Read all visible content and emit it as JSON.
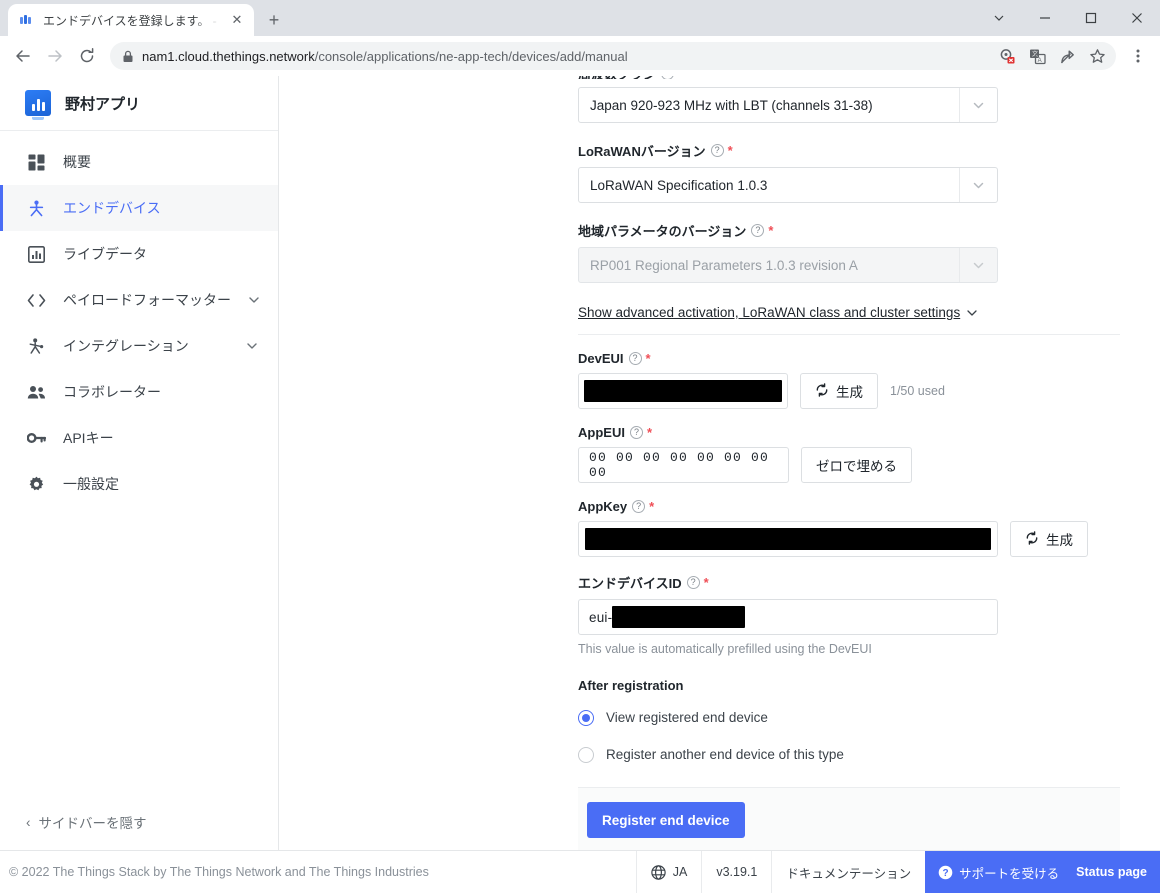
{
  "browser": {
    "tab": {
      "title": "エンドデバイスを登録します。 - 野村ア",
      "favicon_name": "thethings-favicon",
      "close_label": "✕"
    },
    "newtab_label": "+",
    "window_controls": {
      "more": "chevron-down",
      "minimize": "minimize",
      "maximize": "maximize",
      "close": "close"
    },
    "nav": {
      "back": "←",
      "forward": "→",
      "reload": "⟳"
    },
    "url_secure": "nam1.cloud.thethings.network",
    "url_path": "/console/applications/ne-app-tech/devices/add/manual",
    "omnibox_icons": [
      "cookie-blocked-icon",
      "translate-icon",
      "share-icon",
      "bookmark-star-icon"
    ],
    "menu_label": "⋮"
  },
  "sidebar": {
    "brand": "野村アプリ",
    "items": [
      {
        "label": "概要",
        "icon": "overview-grid-icon",
        "active": false,
        "expandable": false
      },
      {
        "label": "エンドデバイス",
        "icon": "end-device-icon",
        "active": true,
        "expandable": false
      },
      {
        "label": "ライブデータ",
        "icon": "live-data-icon",
        "active": false,
        "expandable": false
      },
      {
        "label": "ペイロードフォーマッター",
        "icon": "code-brackets-icon",
        "active": false,
        "expandable": true
      },
      {
        "label": "インテグレーション",
        "icon": "integration-icon",
        "active": false,
        "expandable": true
      },
      {
        "label": "コラボレーター",
        "icon": "collaborators-icon",
        "active": false,
        "expandable": false
      },
      {
        "label": "APIキー",
        "icon": "key-icon",
        "active": false,
        "expandable": false
      },
      {
        "label": "一般設定",
        "icon": "gear-icon",
        "active": false,
        "expandable": false
      }
    ],
    "collapse_label": "サイドバーを隠す",
    "collapse_caret": "‹"
  },
  "form": {
    "frequency_plan": {
      "label": "周波数プラン",
      "value": "Japan 920-923 MHz with LBT (channels 31-38)",
      "required": false,
      "disabled": false
    },
    "lorawan_version": {
      "label": "LoRaWANバージョン",
      "value": "LoRaWAN Specification 1.0.3",
      "required": true,
      "disabled": false
    },
    "regional_parameters": {
      "label": "地域パラメータのバージョン",
      "value": "RP001 Regional Parameters 1.0.3 revision A",
      "required": true,
      "disabled": true
    },
    "advanced_toggle": "Show advanced activation, LoRaWAN class and cluster settings",
    "dev_eui": {
      "label": "DevEUI",
      "required": true,
      "value_redacted": true,
      "generate_button": "生成",
      "used_note": "1/50 used"
    },
    "app_eui": {
      "label": "AppEUI",
      "required": true,
      "value": "00 00 00 00 00 00 00 00",
      "fill_button": "ゼロで埋める"
    },
    "app_key": {
      "label": "AppKey",
      "required": true,
      "value_redacted": true,
      "generate_button": "生成"
    },
    "end_device_id": {
      "label": "エンドデバイスID",
      "required": true,
      "value_prefix": "eui-",
      "value_redacted": true,
      "help": "This value is automatically prefilled using the DevEUI"
    },
    "after_registration": {
      "title": "After registration",
      "options": [
        {
          "label": "View registered end device",
          "selected": true
        },
        {
          "label": "Register another end device of this type",
          "selected": false
        }
      ]
    },
    "submit_button": "Register end device",
    "help_marker": "?"
  },
  "footer": {
    "copyright": "© 2022 The Things Stack by The Things Network and The Things Industries",
    "language": "JA",
    "version": "v3.19.1",
    "documentation": "ドキュメンテーション",
    "support": "サポートを受ける",
    "status_page": "Status page"
  },
  "colors": {
    "accent": "#4a6df5",
    "required_star": "#ef4e56",
    "text": "#20262c",
    "muted": "#8a9199"
  }
}
